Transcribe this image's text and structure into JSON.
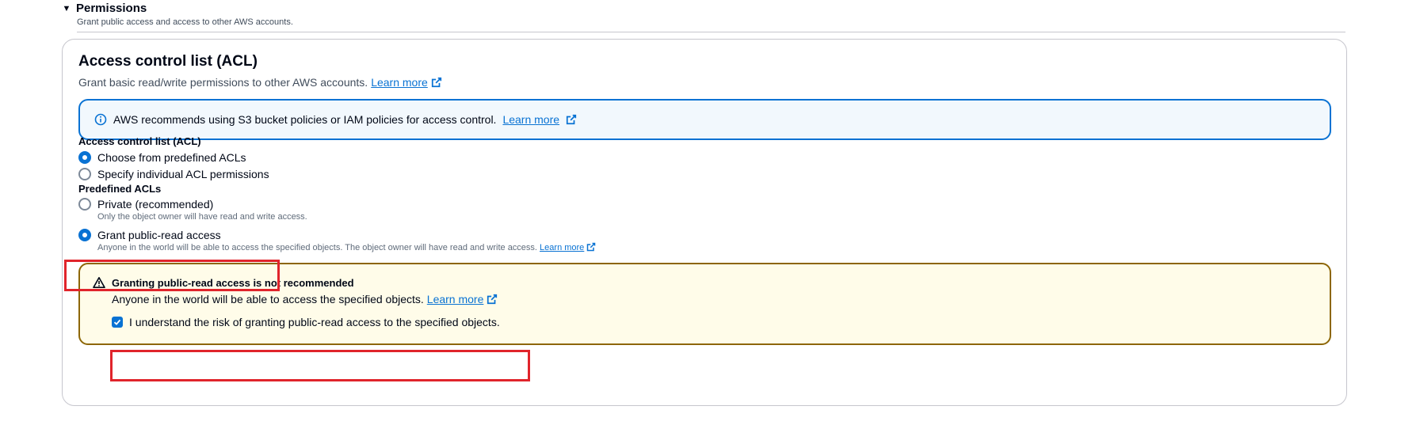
{
  "permissions": {
    "title": "Permissions",
    "description": "Grant public access and access to other AWS accounts."
  },
  "acl_container": {
    "title": "Access control list (ACL)",
    "description": "Grant basic read/write permissions to other AWS accounts.",
    "learn_more": "Learn more"
  },
  "info_alert": {
    "text": "AWS recommends using S3 bucket policies or IAM policies for access control.",
    "learn_more": "Learn more"
  },
  "acl_field": {
    "label": "Access control list (ACL)",
    "options": [
      {
        "label": "Choose from predefined ACLs",
        "selected": true
      },
      {
        "label": "Specify individual ACL permissions",
        "selected": false
      }
    ]
  },
  "predefined_acls": {
    "label": "Predefined ACLs",
    "options": [
      {
        "label": "Private (recommended)",
        "description": "Only the object owner will have read and write access.",
        "selected": false
      },
      {
        "label": "Grant public-read access",
        "description": "Anyone in the world will be able to access the specified objects. The object owner will have read and write access.",
        "learn_more": "Learn more",
        "selected": true
      }
    ]
  },
  "warning_alert": {
    "title": "Granting public-read access is not recommended",
    "text": "Anyone in the world will be able to access the specified objects.",
    "learn_more": "Learn more",
    "checkbox_label": "I understand the risk of granting public-read access to the specified objects.",
    "checkbox_checked": true
  },
  "colors": {
    "link": "#0972d3",
    "info_border": "#0972d3",
    "info_background": "#f2f8fd",
    "warning_border": "#8d6605",
    "warning_background": "#fffce9",
    "highlight": "#e0242b"
  }
}
